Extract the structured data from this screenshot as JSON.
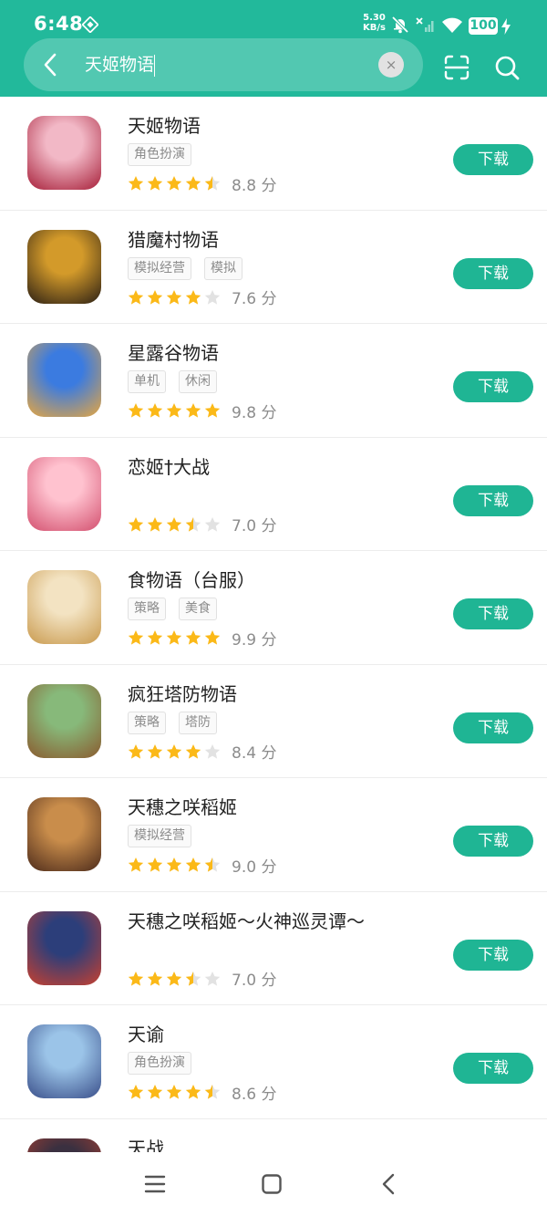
{
  "status_bar": {
    "time": "6:48",
    "net_speed_value": "5.30",
    "net_speed_unit": "KB/s",
    "battery": "100"
  },
  "search": {
    "query": "天姬物语",
    "clear_label": "×"
  },
  "apps": [
    {
      "name": "天姬物语",
      "tags": [
        "角色扮演"
      ],
      "rating": 4.5,
      "score": "8.8 分",
      "button": "下载",
      "icon_colors": [
        "#f2b8c6",
        "#a7203a"
      ]
    },
    {
      "name": "猎魔村物语",
      "tags": [
        "模拟经营",
        "模拟"
      ],
      "rating": 4,
      "score": "7.6 分",
      "button": "下载",
      "icon_colors": [
        "#d39a2a",
        "#2b1f14"
      ]
    },
    {
      "name": "星露谷物语",
      "tags": [
        "单机",
        "休闲"
      ],
      "rating": 5,
      "score": "9.8 分",
      "button": "下载",
      "icon_colors": [
        "#3b7be0",
        "#e6a640"
      ]
    },
    {
      "name": "恋姬†大战",
      "tags": [],
      "rating": 3.5,
      "score": "7.0 分",
      "button": "下载",
      "icon_colors": [
        "#ffc2cf",
        "#d3506f"
      ]
    },
    {
      "name": "食物语（台服）",
      "tags": [
        "策略",
        "美食"
      ],
      "rating": 5,
      "score": "9.9 分",
      "button": "下载",
      "icon_colors": [
        "#f3e3c2",
        "#c99a4e"
      ]
    },
    {
      "name": "疯狂塔防物语",
      "tags": [
        "策略",
        "塔防"
      ],
      "rating": 4,
      "score": "8.4 分",
      "button": "下载",
      "icon_colors": [
        "#87b97a",
        "#8a5a2e"
      ]
    },
    {
      "name": "天穗之咲稻姬",
      "tags": [
        "模拟经营"
      ],
      "rating": 4.5,
      "score": "9.0 分",
      "button": "下载",
      "icon_colors": [
        "#c98d4b",
        "#4d2b1b"
      ]
    },
    {
      "name": "天穗之咲稻姬～火神巡灵谭～",
      "tags": [],
      "rating": 3.5,
      "score": "7.0 分",
      "button": "下载",
      "icon_colors": [
        "#2c3e7a",
        "#c8402f"
      ]
    },
    {
      "name": "天谕",
      "tags": [
        "角色扮演"
      ],
      "rating": 4.5,
      "score": "8.6 分",
      "button": "下载",
      "icon_colors": [
        "#9bc4e8",
        "#3a4f8a"
      ]
    },
    {
      "name": "天战",
      "tags": [],
      "rating": 0,
      "score": "",
      "button": "",
      "icon_colors": [
        "#3a3040",
        "#b04030"
      ]
    }
  ],
  "icons": {
    "back": "chevron-left-icon",
    "clear": "close-icon",
    "scan": "scan-icon",
    "search": "search-icon",
    "nav_menu": "menu-icon",
    "nav_home": "home-square-icon",
    "nav_back": "back-chevron-icon"
  },
  "colors": {
    "brand": "#22b99b",
    "button": "#1fb594",
    "star": "#fbb918",
    "star_empty": "#e2e2e2"
  }
}
